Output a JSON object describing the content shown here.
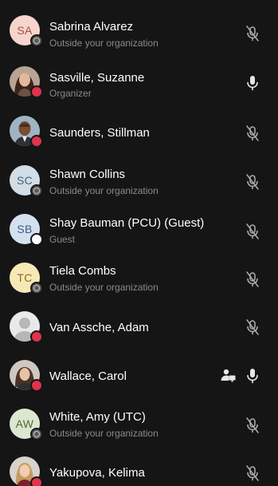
{
  "colors": {
    "background": "#151515",
    "status_busy": "#e0334c",
    "status_external": "#5a5a5a",
    "status_available": "#ffffff"
  },
  "participants": [
    {
      "name": "Sabrina Alvarez",
      "subtitle": "Outside your organization",
      "initials": "SA",
      "avatar_bg": "#f6d5cc",
      "avatar_fg": "#a8503c",
      "status": "external",
      "mic": "muted"
    },
    {
      "name": "Sasville, Suzanne",
      "subtitle": "Organizer",
      "initials": "",
      "avatar_photo": "woman-dark-hair",
      "status": "busy",
      "mic": "on"
    },
    {
      "name": "Saunders, Stillman",
      "subtitle": "",
      "initials": "",
      "avatar_photo": "man-bald",
      "status": "busy",
      "mic": "muted"
    },
    {
      "name": "Shawn Collins",
      "subtitle": "Outside your organization",
      "initials": "SC",
      "avatar_bg": "#d2dde6",
      "avatar_fg": "#4a6278",
      "status": "external",
      "mic": "muted"
    },
    {
      "name": "Shay Bauman (PCU) (Guest)",
      "subtitle": "Guest",
      "initials": "SB",
      "avatar_bg": "#d5e0ef",
      "avatar_fg": "#3d5a86",
      "status": "available",
      "mic": "muted"
    },
    {
      "name": "Tiela Combs",
      "subtitle": "Outside your organization",
      "initials": "TC",
      "avatar_bg": "#f7e9b6",
      "avatar_fg": "#8a6d1e",
      "status": "external",
      "mic": "muted"
    },
    {
      "name": "Van Assche, Adam",
      "subtitle": "",
      "initials": "",
      "avatar_photo": "default-person",
      "status": "busy",
      "mic": "muted"
    },
    {
      "name": "Wallace, Carol",
      "subtitle": "",
      "initials": "",
      "avatar_photo": "woman-brown-hair",
      "status": "busy",
      "mic": "on",
      "sharing": true
    },
    {
      "name": "White, Amy (UTC)",
      "subtitle": "Outside your organization",
      "initials": "AW",
      "avatar_bg": "#dbe8cf",
      "avatar_fg": "#4f6b35",
      "status": "external",
      "mic": "muted"
    },
    {
      "name": "Yakupova, Kelima",
      "subtitle": "",
      "initials": "",
      "avatar_photo": "woman-blonde",
      "status": "busy",
      "mic": "muted"
    }
  ]
}
